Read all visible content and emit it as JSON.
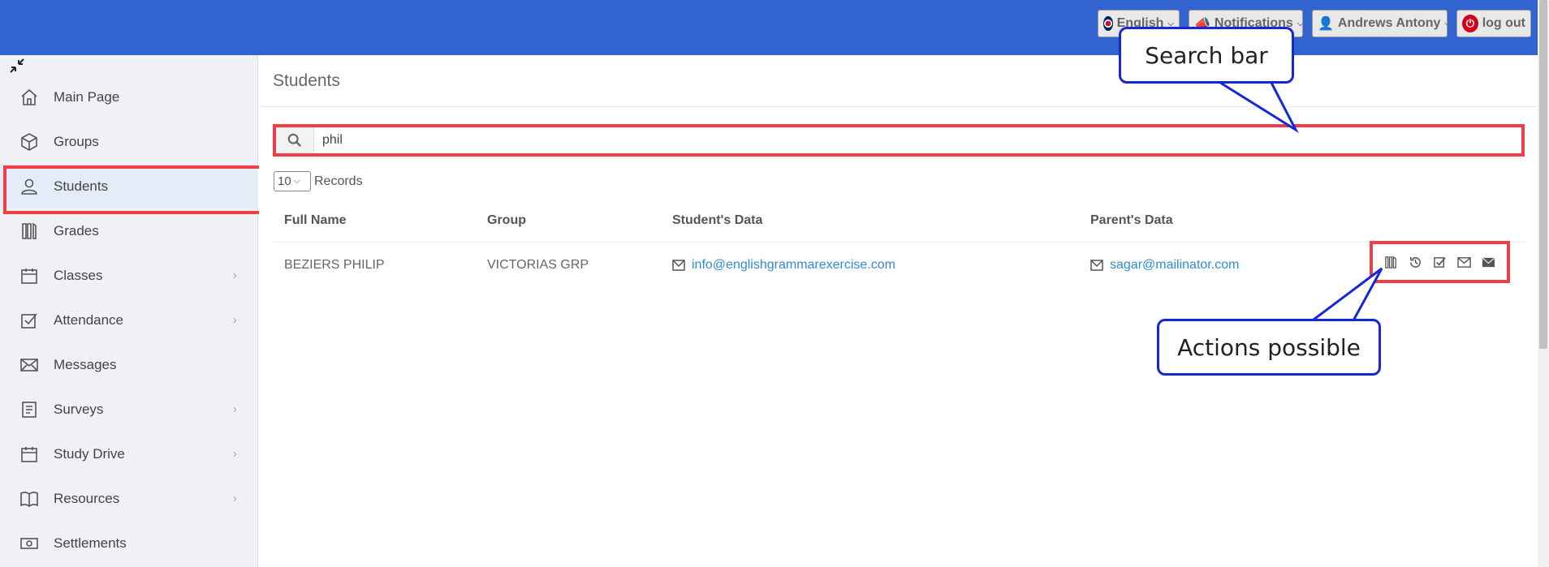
{
  "topbar": {
    "language": "English",
    "notifications": "Notifications",
    "user": "Andrews Antony",
    "logout": "log out"
  },
  "sidebar": {
    "items": [
      {
        "label": "Main Page",
        "icon": "home-icon",
        "has_arrow": false
      },
      {
        "label": "Groups",
        "icon": "cube-icon",
        "has_arrow": false
      },
      {
        "label": "Students",
        "icon": "user-icon",
        "has_arrow": false
      },
      {
        "label": "Grades",
        "icon": "grades-icon",
        "has_arrow": false
      },
      {
        "label": "Classes",
        "icon": "calendar-icon",
        "has_arrow": true
      },
      {
        "label": "Attendance",
        "icon": "checkbox-icon",
        "has_arrow": true
      },
      {
        "label": "Messages",
        "icon": "envelope-icon",
        "has_arrow": false
      },
      {
        "label": "Surveys",
        "icon": "document-icon",
        "has_arrow": true
      },
      {
        "label": "Study Drive",
        "icon": "calendar-icon",
        "has_arrow": true
      },
      {
        "label": "Resources",
        "icon": "book-icon",
        "has_arrow": true
      },
      {
        "label": "Settlements",
        "icon": "money-icon",
        "has_arrow": false
      }
    ]
  },
  "main": {
    "title": "Students",
    "search": {
      "value": "phil"
    },
    "records": {
      "selected": "10",
      "label": "Records"
    },
    "table": {
      "columns": [
        "Full Name",
        "Group",
        "Student's Data",
        "Parent's Data"
      ],
      "rows": [
        {
          "full_name": "BEZIERS PHILIP",
          "group": "VICTORIAS GRP",
          "student_email": "info@englishgrammarexercise.com",
          "parent_email": "sagar@mailinator.com"
        }
      ]
    }
  },
  "callouts": {
    "search": "Search bar",
    "actions": "Actions possible"
  },
  "colors": {
    "topbar": "#3264d0",
    "highlight": "#ef3e48",
    "callout_border": "#1428d8",
    "link": "#2f8bd7"
  }
}
